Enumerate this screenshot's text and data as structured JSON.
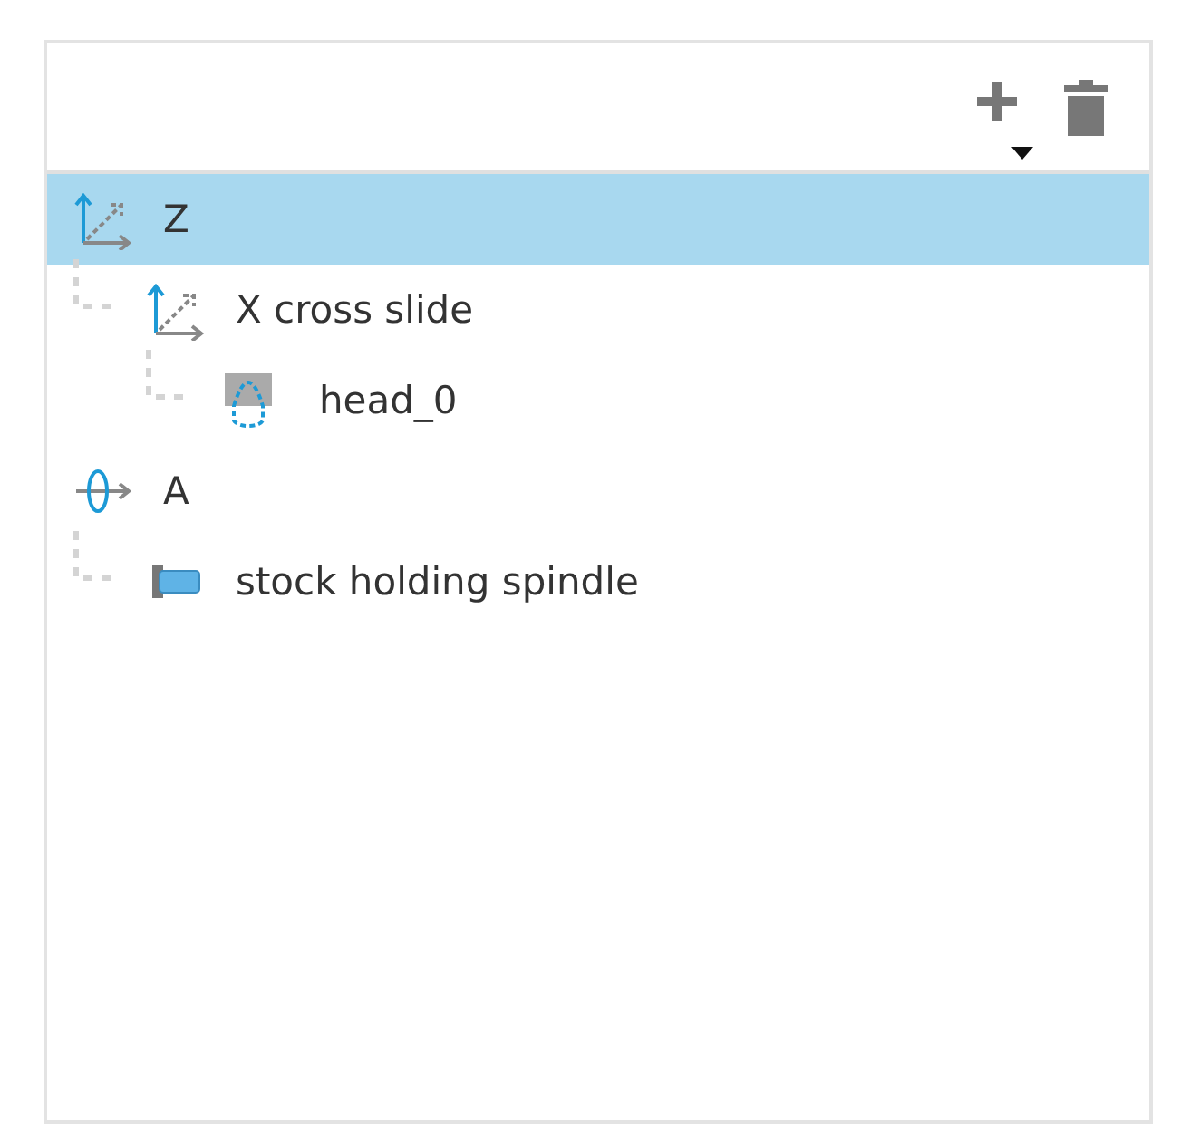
{
  "tree": [
    {
      "label": "Z",
      "kind": "linear-axis",
      "selected": true,
      "children": [
        {
          "label": "X cross slide",
          "kind": "linear-axis",
          "selected": false,
          "children": [
            {
              "label": "head_0",
              "kind": "head",
              "selected": false
            }
          ]
        }
      ]
    },
    {
      "label": "A",
      "kind": "rotary-axis",
      "selected": false,
      "children": [
        {
          "label": "stock holding spindle",
          "kind": "spindle",
          "selected": false
        }
      ]
    }
  ]
}
